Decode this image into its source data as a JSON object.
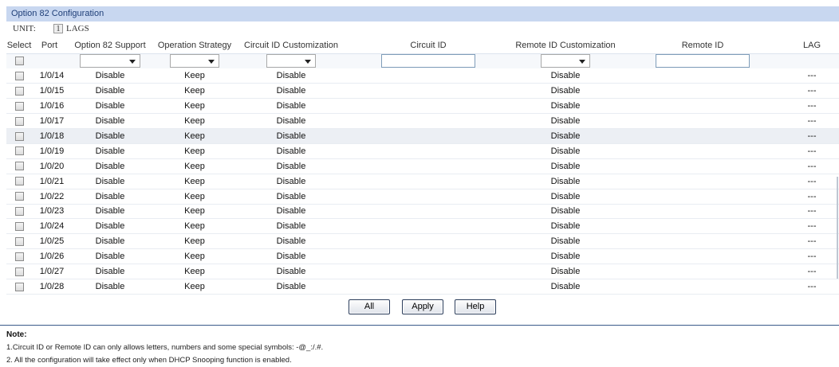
{
  "panel": {
    "title": "Option 82 Configuration"
  },
  "unit": {
    "label": "UNIT:",
    "number": "1",
    "lags": "LAGS"
  },
  "columns": [
    "Select",
    "Port",
    "Option 82 Support",
    "Operation Strategy",
    "Circuit ID Customization",
    "Circuit ID",
    "Remote ID Customization",
    "Remote ID",
    "LAG"
  ],
  "filter": {
    "option82_selected": "",
    "strategy_selected": "",
    "circuit_custom_selected": "",
    "circuit_id_value": "",
    "remote_custom_selected": "",
    "remote_id_value": ""
  },
  "rows": [
    {
      "port": "1/0/14",
      "support": "Disable",
      "strategy": "Keep",
      "circuit_custom": "Disable",
      "circuit_id": "",
      "remote_custom": "Disable",
      "remote_id": "",
      "lag": "---"
    },
    {
      "port": "1/0/15",
      "support": "Disable",
      "strategy": "Keep",
      "circuit_custom": "Disable",
      "circuit_id": "",
      "remote_custom": "Disable",
      "remote_id": "",
      "lag": "---"
    },
    {
      "port": "1/0/16",
      "support": "Disable",
      "strategy": "Keep",
      "circuit_custom": "Disable",
      "circuit_id": "",
      "remote_custom": "Disable",
      "remote_id": "",
      "lag": "---"
    },
    {
      "port": "1/0/17",
      "support": "Disable",
      "strategy": "Keep",
      "circuit_custom": "Disable",
      "circuit_id": "",
      "remote_custom": "Disable",
      "remote_id": "",
      "lag": "---"
    },
    {
      "port": "1/0/18",
      "support": "Disable",
      "strategy": "Keep",
      "circuit_custom": "Disable",
      "circuit_id": "",
      "remote_custom": "Disable",
      "remote_id": "",
      "lag": "---"
    },
    {
      "port": "1/0/19",
      "support": "Disable",
      "strategy": "Keep",
      "circuit_custom": "Disable",
      "circuit_id": "",
      "remote_custom": "Disable",
      "remote_id": "",
      "lag": "---"
    },
    {
      "port": "1/0/20",
      "support": "Disable",
      "strategy": "Keep",
      "circuit_custom": "Disable",
      "circuit_id": "",
      "remote_custom": "Disable",
      "remote_id": "",
      "lag": "---"
    },
    {
      "port": "1/0/21",
      "support": "Disable",
      "strategy": "Keep",
      "circuit_custom": "Disable",
      "circuit_id": "",
      "remote_custom": "Disable",
      "remote_id": "",
      "lag": "---"
    },
    {
      "port": "1/0/22",
      "support": "Disable",
      "strategy": "Keep",
      "circuit_custom": "Disable",
      "circuit_id": "",
      "remote_custom": "Disable",
      "remote_id": "",
      "lag": "---"
    },
    {
      "port": "1/0/23",
      "support": "Disable",
      "strategy": "Keep",
      "circuit_custom": "Disable",
      "circuit_id": "",
      "remote_custom": "Disable",
      "remote_id": "",
      "lag": "---"
    },
    {
      "port": "1/0/24",
      "support": "Disable",
      "strategy": "Keep",
      "circuit_custom": "Disable",
      "circuit_id": "",
      "remote_custom": "Disable",
      "remote_id": "",
      "lag": "---"
    },
    {
      "port": "1/0/25",
      "support": "Disable",
      "strategy": "Keep",
      "circuit_custom": "Disable",
      "circuit_id": "",
      "remote_custom": "Disable",
      "remote_id": "",
      "lag": "---"
    },
    {
      "port": "1/0/26",
      "support": "Disable",
      "strategy": "Keep",
      "circuit_custom": "Disable",
      "circuit_id": "",
      "remote_custom": "Disable",
      "remote_id": "",
      "lag": "---"
    },
    {
      "port": "1/0/27",
      "support": "Disable",
      "strategy": "Keep",
      "circuit_custom": "Disable",
      "circuit_id": "",
      "remote_custom": "Disable",
      "remote_id": "",
      "lag": "---"
    },
    {
      "port": "1/0/28",
      "support": "Disable",
      "strategy": "Keep",
      "circuit_custom": "Disable",
      "circuit_id": "",
      "remote_custom": "Disable",
      "remote_id": "",
      "lag": "---"
    }
  ],
  "highlighted_row": "1/0/18",
  "buttons": {
    "all": "All",
    "apply": "Apply",
    "help": "Help"
  },
  "note": {
    "title": "Note:",
    "lines": [
      "1.Circuit ID or Remote ID can only allows letters, numbers and some special symbols: -@_:/.#.",
      "2. All the configuration will take effect only when DHCP Snooping function is enabled."
    ]
  },
  "colors": {
    "panel_header_bg": "#c8d7f0",
    "panel_header_text": "#1f3f78",
    "note_rule": "#3a5a8a",
    "row_highlight": "#eceff4"
  },
  "icons": {
    "dropdown": "chevron-down-icon",
    "checkbox": "checkbox-icon"
  }
}
